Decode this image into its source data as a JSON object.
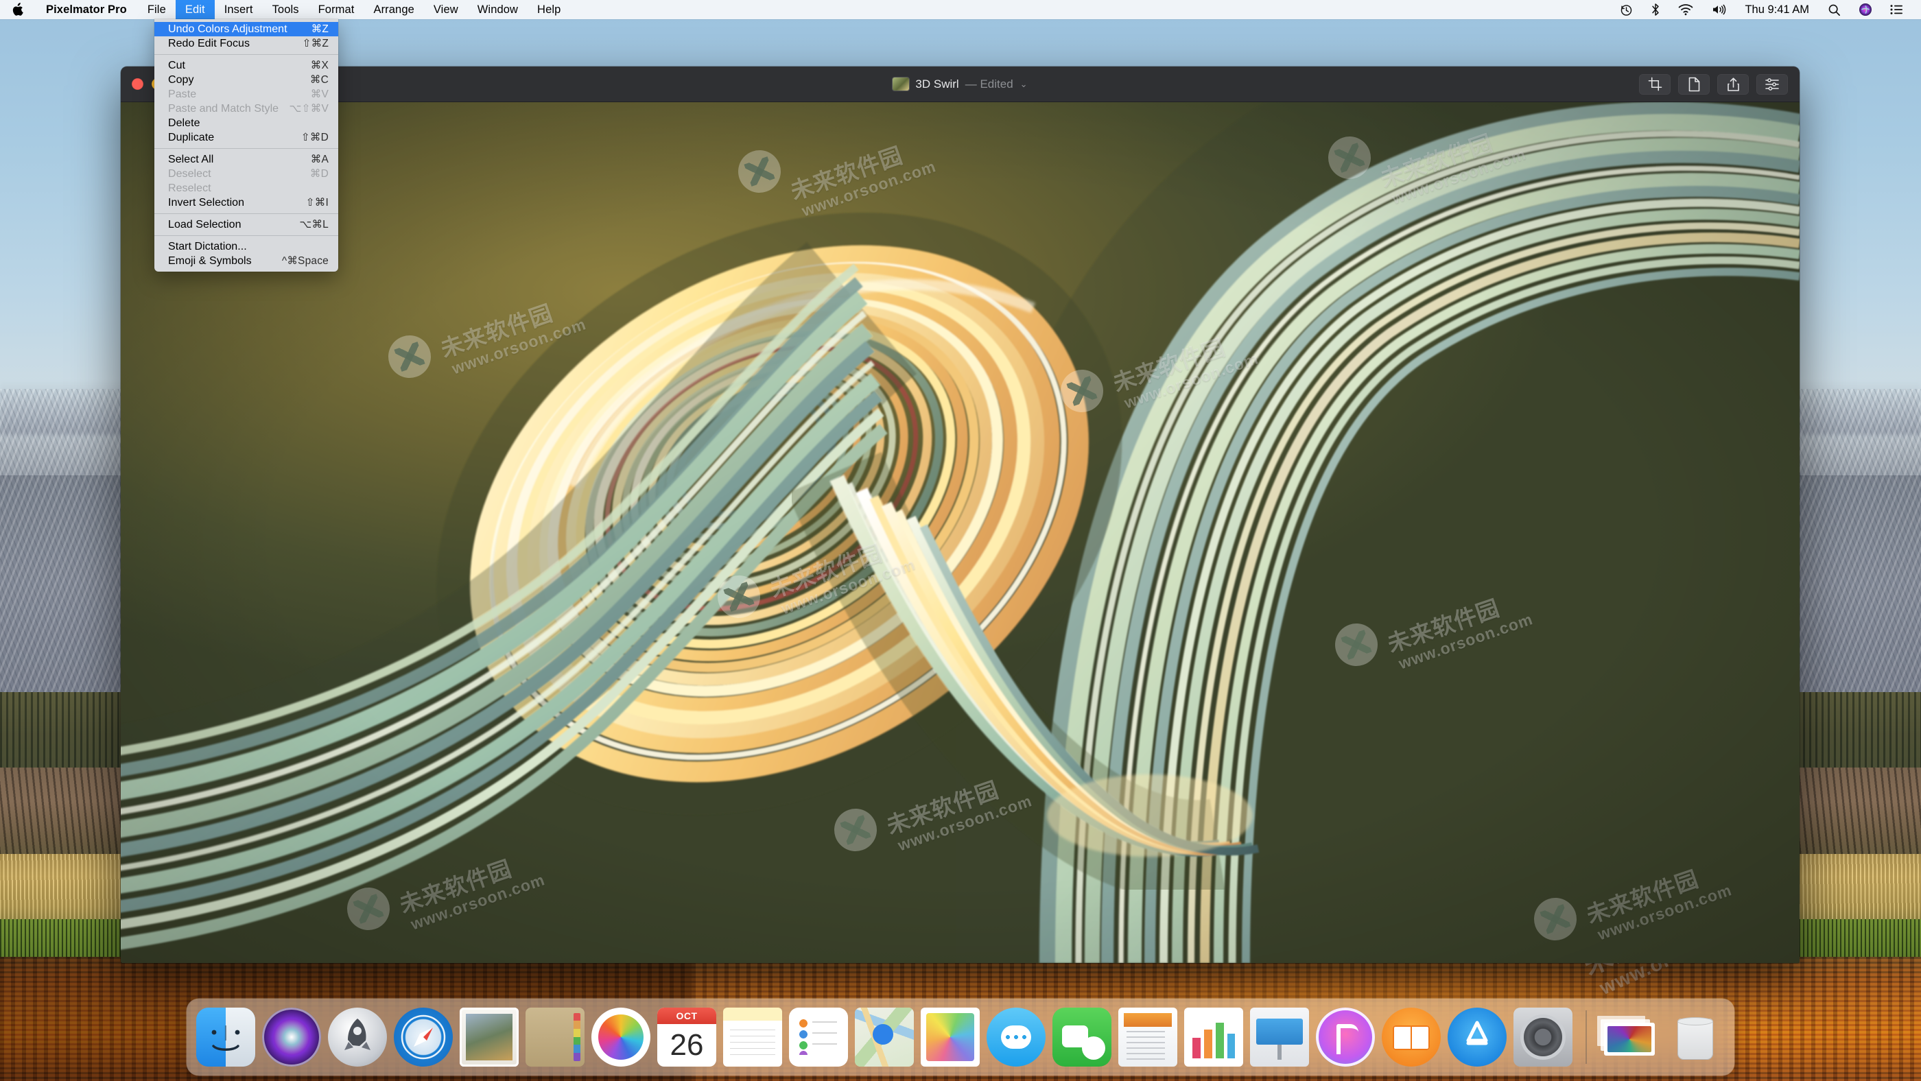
{
  "menubar": {
    "apple_glyph": "",
    "app_name": "Pixelmator Pro",
    "items": [
      "File",
      "Edit",
      "Insert",
      "Tools",
      "Format",
      "Arrange",
      "View",
      "Window",
      "Help"
    ],
    "active_item": "Edit",
    "clock": "Thu 9:41 AM",
    "status_icons": [
      {
        "name": "time-machine-icon",
        "glyph": "↺"
      },
      {
        "name": "bluetooth-icon",
        "glyph": "ᛗ"
      },
      {
        "name": "wifi-icon",
        "glyph": "◠"
      },
      {
        "name": "volume-icon",
        "glyph": "🔊"
      },
      {
        "name": "spotlight-search-icon",
        "glyph": "⌕"
      },
      {
        "name": "siri-icon",
        "glyph": "◉"
      },
      {
        "name": "control-center-icon",
        "glyph": "☰"
      }
    ]
  },
  "edit_menu": {
    "open": true,
    "highlight_color": "#2d7ff0",
    "groups": [
      [
        {
          "label": "Undo Colors Adjustment",
          "shortcut": "⌘Z",
          "selected": true,
          "disabled": false
        },
        {
          "label": "Redo Edit Focus",
          "shortcut": "⇧⌘Z",
          "selected": false,
          "disabled": false
        }
      ],
      [
        {
          "label": "Cut",
          "shortcut": "⌘X",
          "selected": false,
          "disabled": false
        },
        {
          "label": "Copy",
          "shortcut": "⌘C",
          "selected": false,
          "disabled": false
        },
        {
          "label": "Paste",
          "shortcut": "⌘V",
          "selected": false,
          "disabled": true
        },
        {
          "label": "Paste and Match Style",
          "shortcut": "⌥⇧⌘V",
          "selected": false,
          "disabled": true
        },
        {
          "label": "Delete",
          "shortcut": "",
          "selected": false,
          "disabled": false
        },
        {
          "label": "Duplicate",
          "shortcut": "⇧⌘D",
          "selected": false,
          "disabled": false
        }
      ],
      [
        {
          "label": "Select All",
          "shortcut": "⌘A",
          "selected": false,
          "disabled": false
        },
        {
          "label": "Deselect",
          "shortcut": "⌘D",
          "selected": false,
          "disabled": true
        },
        {
          "label": "Reselect",
          "shortcut": "",
          "selected": false,
          "disabled": true
        },
        {
          "label": "Invert Selection",
          "shortcut": "⇧⌘I",
          "selected": false,
          "disabled": false
        }
      ],
      [
        {
          "label": "Load Selection",
          "shortcut": "⌥⌘L",
          "selected": false,
          "disabled": false
        }
      ],
      [
        {
          "label": "Start Dictation...",
          "shortcut": "",
          "selected": false,
          "disabled": false
        },
        {
          "label": "Emoji & Symbols",
          "shortcut": "^⌘Space",
          "selected": false,
          "disabled": false
        }
      ]
    ]
  },
  "window": {
    "title": "3D Swirl",
    "edited_label": "— Edited",
    "chevron": "⌄",
    "titlebar_color": "#2f3033",
    "traffic_lights": [
      {
        "name": "close-button",
        "color": "#ff5f57"
      },
      {
        "name": "minimize-button",
        "color": "#febc2e"
      },
      {
        "name": "zoom-button",
        "color": "#28c840"
      }
    ],
    "toolbar_buttons": [
      {
        "name": "crop-tool-button",
        "icon": "crop-icon"
      },
      {
        "name": "new-document-button",
        "icon": "document-icon"
      },
      {
        "name": "share-button",
        "icon": "share-icon"
      },
      {
        "name": "adjustments-button",
        "icon": "sliders-icon"
      }
    ]
  },
  "canvas": {
    "artwork_name": "3D Swirl",
    "background_colors": [
      "#8d7f3f",
      "#4a4f2f",
      "#363d27"
    ],
    "ribbon_colors": [
      "#f7e5a8",
      "#f2c87a",
      "#e8a45e",
      "#d9e3c4",
      "#9fc0ae",
      "#6f9a8c",
      "#c8564f",
      "#ffffff"
    ],
    "watermarks": [
      {
        "cn": "未来软件园",
        "url": "www.orsoon.com"
      }
    ]
  },
  "desktop": {
    "wallpaper_name": "High Sierra"
  },
  "dock": {
    "items": [
      {
        "name": "finder",
        "label": "Finder",
        "running": true
      },
      {
        "name": "siri",
        "label": "Siri",
        "running": false
      },
      {
        "name": "launchpad",
        "label": "Launchpad",
        "running": false
      },
      {
        "name": "safari",
        "label": "Safari",
        "running": false
      },
      {
        "name": "mail",
        "label": "Mail",
        "running": false
      },
      {
        "name": "contacts",
        "label": "Contacts",
        "running": false
      },
      {
        "name": "photos",
        "label": "Photos",
        "running": false
      },
      {
        "name": "calendar",
        "label": "Calendar",
        "running": false,
        "month": "OCT",
        "day": "26"
      },
      {
        "name": "notes",
        "label": "Notes",
        "running": false
      },
      {
        "name": "reminders",
        "label": "Reminders",
        "running": false
      },
      {
        "name": "maps",
        "label": "Maps",
        "running": false
      },
      {
        "name": "preview",
        "label": "Preview",
        "running": false
      },
      {
        "name": "messages",
        "label": "Messages",
        "running": false
      },
      {
        "name": "facetime",
        "label": "FaceTime",
        "running": false
      },
      {
        "name": "pages",
        "label": "Pages",
        "running": false
      },
      {
        "name": "numbers",
        "label": "Numbers",
        "running": false
      },
      {
        "name": "keynote",
        "label": "Keynote",
        "running": false
      },
      {
        "name": "itunes",
        "label": "iTunes",
        "running": false
      },
      {
        "name": "books",
        "label": "Books",
        "running": false
      },
      {
        "name": "app-store",
        "label": "App Store",
        "running": false
      },
      {
        "name": "system-preferences",
        "label": "System Preferences",
        "running": false
      },
      {
        "name": "downloads",
        "label": "Downloads",
        "running": false
      },
      {
        "name": "trash",
        "label": "Trash",
        "running": false
      }
    ],
    "app_store_glyph": "A"
  }
}
